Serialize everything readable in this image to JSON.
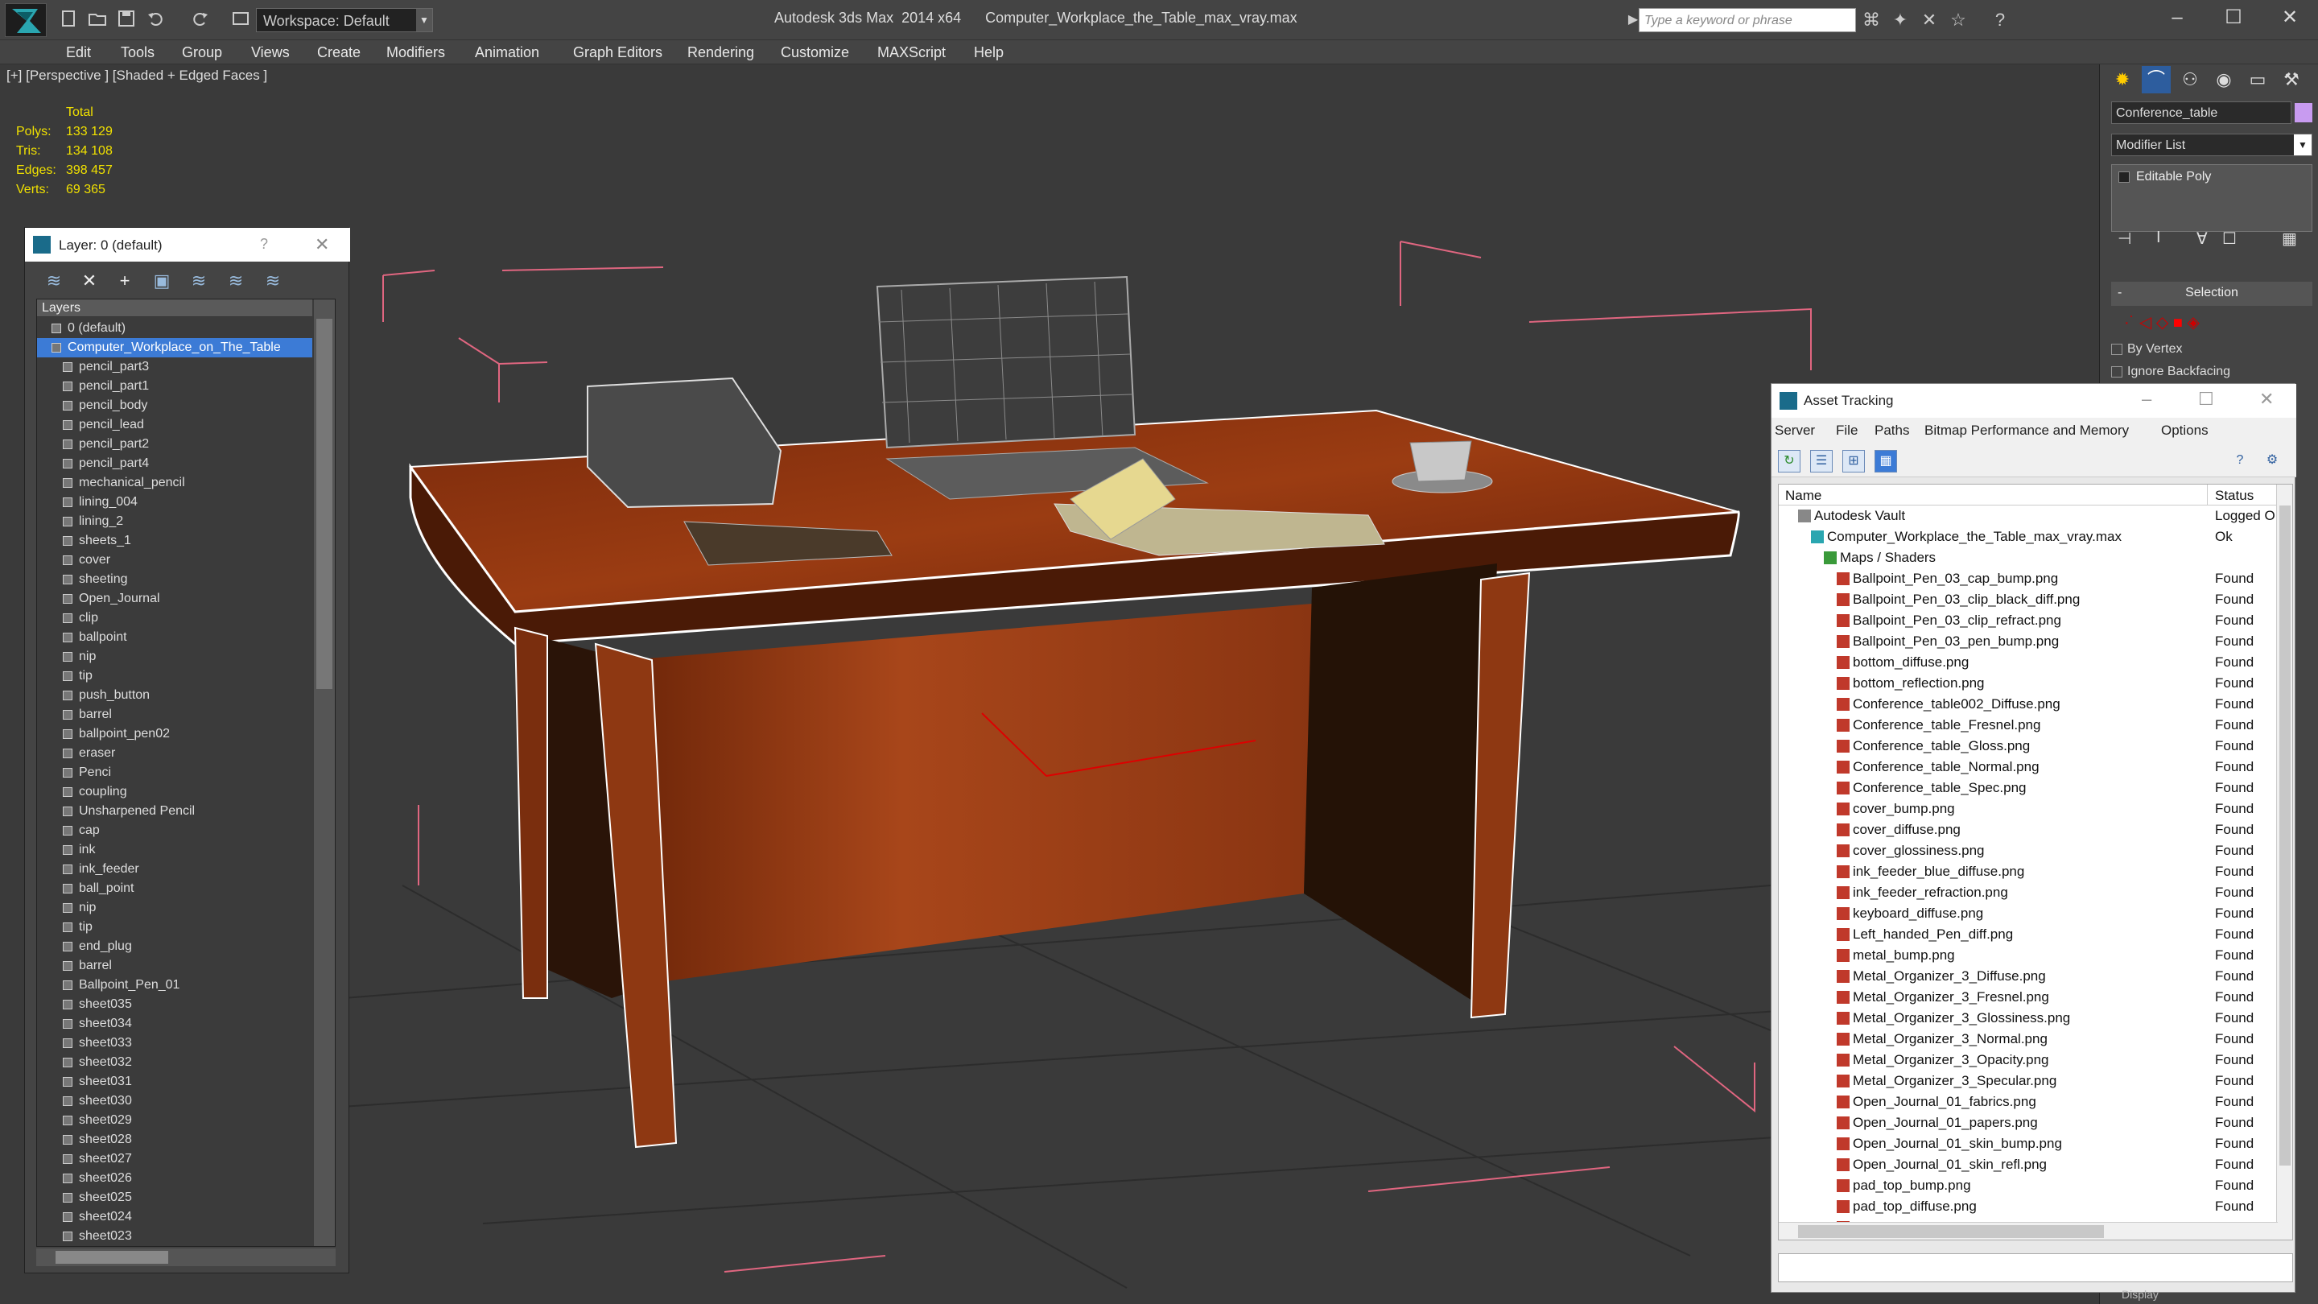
{
  "window": {
    "title": "Autodesk 3ds Max  2014 x64      Computer_Workplace_the_Table_max_vray.max",
    "workspace": "Workspace: Default",
    "search_placeholder": "Type a keyword or phrase"
  },
  "menu": [
    "Edit",
    "Tools",
    "Group",
    "Views",
    "Create",
    "Modifiers",
    "Animation",
    "Graph Editors",
    "Rendering",
    "Customize",
    "MAXScript",
    "Help"
  ],
  "viewport": {
    "label": "[+] [Perspective ] [Shaded + Edged Faces ]",
    "stats": {
      "header": "Total",
      "polys_label": "Polys:",
      "polys": "133 129",
      "tris_label": "Tris:",
      "tris": "134 108",
      "edges_label": "Edges:",
      "edges": "398 457",
      "verts_label": "Verts:",
      "verts": "69 365"
    }
  },
  "layer_panel": {
    "title": "Layer: 0 (default)",
    "help": "?",
    "column_header": "Layers",
    "layers": [
      "0 (default)",
      "Computer_Workplace_on_The_Table",
      "pencil_part3",
      "pencil_part1",
      "pencil_body",
      "pencil_lead",
      "pencil_part2",
      "pencil_part4",
      "mechanical_pencil",
      "lining_004",
      "lining_2",
      "sheets_1",
      "cover",
      "sheeting",
      "Open_Journal",
      "clip",
      "ballpoint",
      "nip",
      "tip",
      "push_button",
      "barrel",
      "ballpoint_pen02",
      "eraser",
      "Penci",
      "coupling",
      "Unsharpened Pencil",
      "cap",
      "ink",
      "ink_feeder",
      "ball_point",
      "nip",
      "tip",
      "end_plug",
      "barrel",
      "Ballpoint_Pen_01",
      "sheet035",
      "sheet034",
      "sheet033",
      "sheet032",
      "sheet031",
      "sheet030",
      "sheet029",
      "sheet028",
      "sheet027",
      "sheet026",
      "sheet025",
      "sheet024",
      "sheet023"
    ],
    "selected_index": 1
  },
  "command_panel": {
    "object_name": "Conference_table",
    "object_color": "#c89bf0",
    "modifier_list": "Modifier List",
    "stack_item": "Editable Poly",
    "rollout": "Selection",
    "rollout_toggle": "-",
    "options": [
      "By Vertex",
      "Ignore Backfacing"
    ],
    "bottom_label": "Display"
  },
  "asset_tracking": {
    "title": "Asset Tracking",
    "menu": [
      "Server",
      "File",
      "Paths",
      "Bitmap Performance and Memory",
      "Options"
    ],
    "col_name": "Name",
    "col_status": "Status",
    "rows": [
      {
        "name": "Autodesk Vault",
        "status": "Logged O",
        "level": 1,
        "icon": "vault-icon"
      },
      {
        "name": "Computer_Workplace_the_Table_max_vray.max",
        "status": "Ok",
        "level": 2,
        "icon": "max-file-icon"
      },
      {
        "name": "Maps / Shaders",
        "status": "",
        "level": 3,
        "icon": "folder-icon"
      },
      {
        "name": "Ballpoint_Pen_03_cap_bump.png",
        "status": "Found",
        "level": 4,
        "icon": "png-icon"
      },
      {
        "name": "Ballpoint_Pen_03_clip_black_diff.png",
        "status": "Found",
        "level": 4,
        "icon": "png-icon"
      },
      {
        "name": "Ballpoint_Pen_03_clip_refract.png",
        "status": "Found",
        "level": 4,
        "icon": "png-icon"
      },
      {
        "name": "Ballpoint_Pen_03_pen_bump.png",
        "status": "Found",
        "level": 4,
        "icon": "png-icon"
      },
      {
        "name": "bottom_diffuse.png",
        "status": "Found",
        "level": 4,
        "icon": "png-icon"
      },
      {
        "name": "bottom_reflection.png",
        "status": "Found",
        "level": 4,
        "icon": "png-icon"
      },
      {
        "name": "Conference_table002_Diffuse.png",
        "status": "Found",
        "level": 4,
        "icon": "png-icon"
      },
      {
        "name": "Conference_table_Fresnel.png",
        "status": "Found",
        "level": 4,
        "icon": "png-icon"
      },
      {
        "name": "Conference_table_Gloss.png",
        "status": "Found",
        "level": 4,
        "icon": "png-icon"
      },
      {
        "name": "Conference_table_Normal.png",
        "status": "Found",
        "level": 4,
        "icon": "png-icon"
      },
      {
        "name": "Conference_table_Spec.png",
        "status": "Found",
        "level": 4,
        "icon": "png-icon"
      },
      {
        "name": "cover_bump.png",
        "status": "Found",
        "level": 4,
        "icon": "png-icon"
      },
      {
        "name": "cover_diffuse.png",
        "status": "Found",
        "level": 4,
        "icon": "png-icon"
      },
      {
        "name": "cover_glossiness.png",
        "status": "Found",
        "level": 4,
        "icon": "png-icon"
      },
      {
        "name": "ink_feeder_blue_diffuse.png",
        "status": "Found",
        "level": 4,
        "icon": "png-icon"
      },
      {
        "name": "ink_feeder_refraction.png",
        "status": "Found",
        "level": 4,
        "icon": "png-icon"
      },
      {
        "name": "keyboard_diffuse.png",
        "status": "Found",
        "level": 4,
        "icon": "png-icon"
      },
      {
        "name": "Left_handed_Pen_diff.png",
        "status": "Found",
        "level": 4,
        "icon": "png-icon"
      },
      {
        "name": "metal_bump.png",
        "status": "Found",
        "level": 4,
        "icon": "png-icon"
      },
      {
        "name": "Metal_Organizer_3_Diffuse.png",
        "status": "Found",
        "level": 4,
        "icon": "png-icon"
      },
      {
        "name": "Metal_Organizer_3_Fresnel.png",
        "status": "Found",
        "level": 4,
        "icon": "png-icon"
      },
      {
        "name": "Metal_Organizer_3_Glossiness.png",
        "status": "Found",
        "level": 4,
        "icon": "png-icon"
      },
      {
        "name": "Metal_Organizer_3_Normal.png",
        "status": "Found",
        "level": 4,
        "icon": "png-icon"
      },
      {
        "name": "Metal_Organizer_3_Opacity.png",
        "status": "Found",
        "level": 4,
        "icon": "png-icon"
      },
      {
        "name": "Metal_Organizer_3_Specular.png",
        "status": "Found",
        "level": 4,
        "icon": "png-icon"
      },
      {
        "name": "Open_Journal_01_fabrics.png",
        "status": "Found",
        "level": 4,
        "icon": "png-icon"
      },
      {
        "name": "Open_Journal_01_papers.png",
        "status": "Found",
        "level": 4,
        "icon": "png-icon"
      },
      {
        "name": "Open_Journal_01_skin_bump.png",
        "status": "Found",
        "level": 4,
        "icon": "png-icon"
      },
      {
        "name": "Open_Journal_01_skin_refl.png",
        "status": "Found",
        "level": 4,
        "icon": "png-icon"
      },
      {
        "name": "pad_top_bump.png",
        "status": "Found",
        "level": 4,
        "icon": "png-icon"
      },
      {
        "name": "pad_top_diffuse.png",
        "status": "Found",
        "level": 4,
        "icon": "png-icon"
      },
      {
        "name": "paper_bump.png",
        "status": "Found",
        "level": 4,
        "icon": "png-icon"
      }
    ]
  }
}
